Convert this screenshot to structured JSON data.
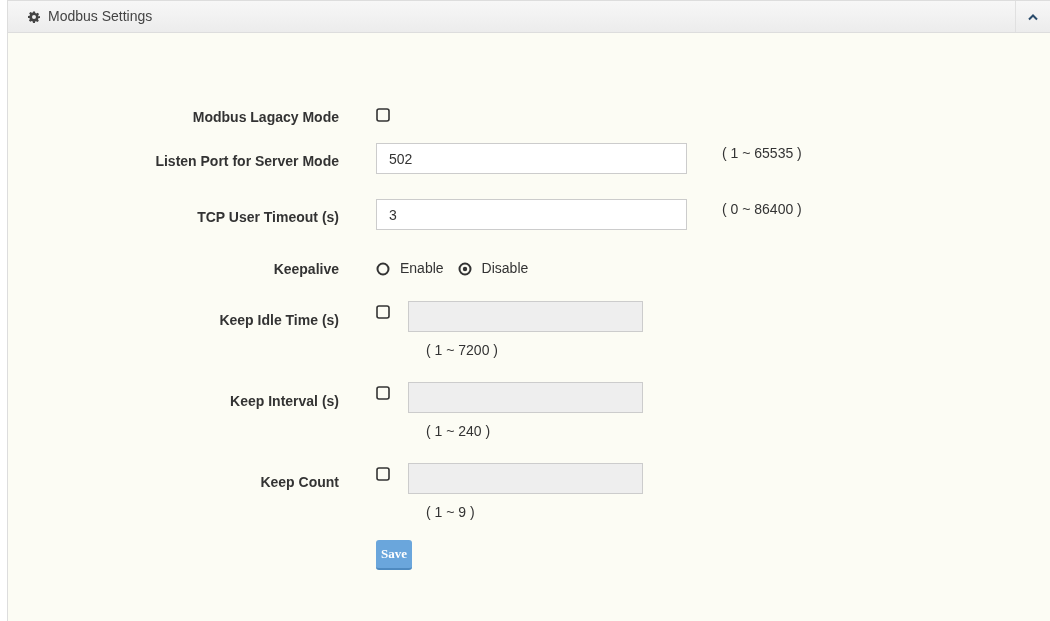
{
  "panel": {
    "title": "Modbus Settings"
  },
  "rows": [
    {
      "kind": "checkbox",
      "label": "Modbus Lagacy Mode",
      "checked": false
    },
    {
      "kind": "text",
      "label": "Listen Port for Server Mode",
      "value": "502",
      "range": "( 1 ~ 65535 )"
    },
    {
      "kind": "text",
      "label": "TCP User Timeout (s)",
      "value": "3",
      "range": "( 0 ~ 86400 )"
    },
    {
      "kind": "radio",
      "label": "Keepalive",
      "options": [
        {
          "label": "Enable",
          "selected": false
        },
        {
          "label": "Disable",
          "selected": true
        }
      ]
    },
    {
      "kind": "checkfield",
      "label": "Keep Idle Time (s)",
      "checked": false,
      "disabled": true,
      "range": "( 1 ~ 7200 )"
    },
    {
      "kind": "checkfield",
      "label": "Keep Interval (s)",
      "checked": false,
      "disabled": true,
      "range": "( 1 ~ 240 )"
    },
    {
      "kind": "checkfield",
      "label": "Keep Count",
      "checked": false,
      "disabled": true,
      "range": "( 1 ~ 9 )"
    }
  ],
  "save_button": "Save"
}
